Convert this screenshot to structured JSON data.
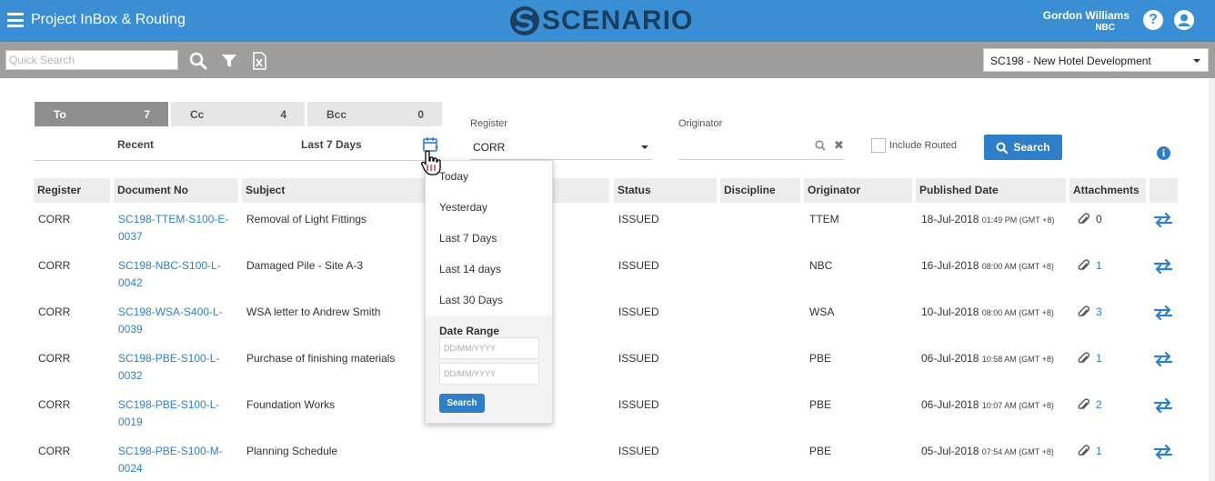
{
  "header": {
    "title": "Project InBox & Routing",
    "logo_text": "SCENARIO",
    "user_name": "Gordon Williams",
    "user_org": "NBC",
    "help_glyph": "?"
  },
  "toolbar": {
    "quick_search_placeholder": "Quick Search",
    "project": "SC198 - New Hotel Development"
  },
  "tabs": [
    {
      "label": "To",
      "count": "7"
    },
    {
      "label": "Cc",
      "count": "4"
    },
    {
      "label": "Bcc",
      "count": "0"
    }
  ],
  "filters": {
    "recent_label": "Recent",
    "range_value": "Last 7 Days",
    "register_label": "Register",
    "register_value": "CORR",
    "originator_label": "Originator",
    "clear_glyph": "✖",
    "include_routed_label": "Include Routed",
    "search_label": "Search",
    "info_glyph": "i"
  },
  "date_dropdown": {
    "options": [
      "Today",
      "Yesterday",
      "Last 7 Days",
      "Last 14 days",
      "Last 30 Days"
    ],
    "range_title": "Date Range",
    "from_placeholder": "DD/MM/YYYY",
    "to_placeholder": "DD/MM/YYYY",
    "search_label": "Search"
  },
  "table": {
    "columns": [
      "Register",
      "Document No",
      "Subject",
      "Status",
      "Discipline",
      "Originator",
      "Published Date",
      "Attachments"
    ],
    "rows": [
      {
        "register": "CORR",
        "doc_line1": "SC198-TTEM-S100-E-",
        "doc_line2": "0037",
        "subject": "Removal of Light Fittings",
        "status": "ISSUED",
        "discipline": "",
        "originator": "TTEM",
        "date": "18-Jul-2018",
        "time": "01:49 PM (GMT +8)",
        "attachments": "0"
      },
      {
        "register": "CORR",
        "doc_line1": "SC198-NBC-S100-L-",
        "doc_line2": "0042",
        "subject": "Damaged Pile - Site A-3",
        "status": "ISSUED",
        "discipline": "",
        "originator": "NBC",
        "date": "16-Jul-2018",
        "time": "08:00 AM (GMT +8)",
        "attachments": "1"
      },
      {
        "register": "CORR",
        "doc_line1": "SC198-WSA-S400-L-",
        "doc_line2": "0039",
        "subject": "WSA letter to Andrew Smith",
        "status": "ISSUED",
        "discipline": "",
        "originator": "WSA",
        "date": "10-Jul-2018",
        "time": "08:00 AM (GMT +8)",
        "attachments": "3"
      },
      {
        "register": "CORR",
        "doc_line1": "SC198-PBE-S100-L-",
        "doc_line2": "0032",
        "subject": "Purchase of finishing materials",
        "status": "ISSUED",
        "discipline": "",
        "originator": "PBE",
        "date": "06-Jul-2018",
        "time": "10:58 AM (GMT +8)",
        "attachments": "1"
      },
      {
        "register": "CORR",
        "doc_line1": "SC198-PBE-S100-L-",
        "doc_line2": "0019",
        "subject": "Foundation Works",
        "status": "ISSUED",
        "discipline": "",
        "originator": "PBE",
        "date": "06-Jul-2018",
        "time": "10:07 AM (GMT +8)",
        "attachments": "2"
      },
      {
        "register": "CORR",
        "doc_line1": "SC198-PBE-S100-M-",
        "doc_line2": "0024",
        "subject": "Planning Schedule",
        "status": "ISSUED",
        "discipline": "",
        "originator": "PBE",
        "date": "05-Jul-2018",
        "time": "07:54 AM (GMT +8)",
        "attachments": "1"
      }
    ]
  },
  "colors": {
    "header_bg": "#3a8fd4",
    "toolbar_bg": "#9e9e9e",
    "accent": "#2f7fc8",
    "logo": "#1b3e5e"
  }
}
